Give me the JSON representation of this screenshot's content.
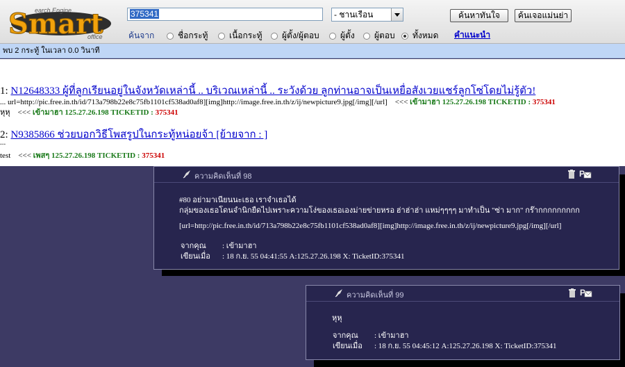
{
  "header": {
    "logo_text": "Smart",
    "logo_sub_top": "earch Engine",
    "logo_sub_bottom": "office",
    "search_value": "375341",
    "select_value": "- ชานเรือน",
    "search_button": "ค้นหาทันใจ",
    "search_button2": "ค้นเจอแม่นย่า",
    "search_from_label": "ค้นจาก",
    "suggest_link": "คำแนะนำ",
    "radios": [
      {
        "label": "ชื่อกระทู้",
        "checked": false
      },
      {
        "label": "เนื้อกระทู้",
        "checked": false
      },
      {
        "label": "ผู้ตั้ง/ผู้ตอบ",
        "checked": false
      },
      {
        "label": "ผู้ตั้ง",
        "checked": false
      },
      {
        "label": "ผู้ตอบ",
        "checked": false
      },
      {
        "label": "ทั้งหมด",
        "checked": true
      }
    ]
  },
  "result_bar": "พบ 2 กระทู้ ในเวลา 0.0 วินาที",
  "results": [
    {
      "num": "1:",
      "title": "N12648333 ผู้ที่ลูกเรียนอยู่ในจังหวัดเหล่านี้ .. บริเวณเหล่านี้ .. ระวังด้วย ลูกท่านอาจเป็นเหยื่อสังเวยแชร์ลูกโซ่โดยไม่รู้ตัว!",
      "line1": {
        "prefix": "... url=http://pic.free.in.th/id/713a798b22e8c75fb1101cf538ad0af8][img]http://image.free.in.th/z/ij/newpicture9.jpg[/img][/url]",
        "arrow": "<<<",
        "green": "เข้ามาฮา 125.27.26.198 TICKETID :",
        "red": "375341"
      },
      "line2": {
        "prefix": "หุหุ",
        "arrow": "<<<",
        "green": "เข้ามาฮา 125.27.26.198 TICKETID :",
        "red": "375341"
      }
    },
    {
      "num": "2:",
      "title": "N9385866 ช่วยบอกวิธีโพสรูปในกระทู้หน่อยจ้า [ย้ายจาก : ]",
      "line1": {
        "prefix": "..."
      },
      "line2": {
        "prefix": "test",
        "arrow": "<<<",
        "green": "เพสๆ 125.27.26.198 TICKETID :",
        "red": "375341"
      }
    }
  ],
  "comments": [
    {
      "title": "ความคิดเห็นที่ 98",
      "lines": [
        "#80 อย่ามาเนียนนะเธอ เราจำเธอได้",
        "กลุ่มของเธอโดนจำนิกยืดไปเพราะความโง่ของเธอเองม่ายข่ายหรอ ฮ่าฮ่าฮ่า แหม่ๆๆๆๆ มาทำเป็น \"ซ่า มาก\" กร๊ากกกกกกกกก",
        "[url=http://pic.free.in.th/id/713a798b22e8c75fb1101cf538ad0af8][img]http://image.free.in.th/z/ij/newpicture9.jpg[/img][/url]"
      ],
      "from_label": "จากคุณ",
      "from_value": ": เข้ามาฮา",
      "when_label": "เขียนเมื่อ",
      "when_value": ": 18 ก.ย. 55 04:41:55 A:125.27.26.198 X: TicketID:375341"
    },
    {
      "title": "ความคิดเห็นที่ 99",
      "lines": [
        "หุหุ"
      ],
      "from_label": "จากคุณ",
      "from_value": ": เข้ามาฮา",
      "when_label": "เขียนเมื่อ",
      "when_value": ": 18 ก.ย. 55 04:45:12 A:125.27.26.198 X: TicketID:375341"
    }
  ],
  "colors": {
    "page_bg": "#3d3a64",
    "link": "#0000cc",
    "ip_green": "#1a7a1a",
    "ticket_red": "#cc0000",
    "comment_bg": "#27254e"
  }
}
